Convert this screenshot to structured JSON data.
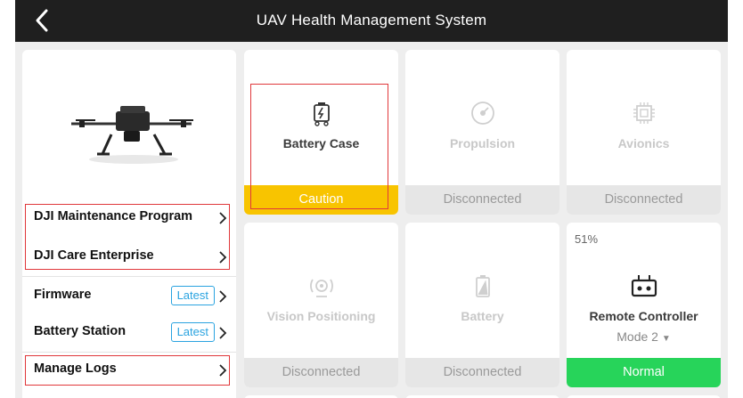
{
  "header": {
    "title": "UAV Health Management System"
  },
  "menu": [
    {
      "label": "DJI Maintenance Program"
    },
    {
      "label": "DJI Care Enterprise"
    },
    {
      "label": "Firmware",
      "badge": "Latest"
    },
    {
      "label": "Battery Station",
      "badge": "Latest"
    },
    {
      "label": "Manage Logs"
    }
  ],
  "modules": [
    {
      "name": "Battery Case",
      "status": "Caution",
      "icon": "battery-case-icon"
    },
    {
      "name": "Propulsion",
      "status": "Disconnected",
      "icon": "propulsion-icon"
    },
    {
      "name": "Avionics",
      "status": "Disconnected",
      "icon": "avionics-chip-icon"
    },
    {
      "name": "Vision Positioning",
      "status": "Disconnected",
      "icon": "vision-positioning-icon"
    },
    {
      "name": "Battery",
      "status": "Disconnected",
      "icon": "battery-icon"
    },
    {
      "name": "Remote Controller",
      "status": "Normal",
      "battery_percent": "51%",
      "mode": "Mode 2",
      "icon": "remote-controller-icon"
    }
  ],
  "colors": {
    "caution": "#f8c400",
    "normal": "#27d45a",
    "highlight": "#e0383b",
    "badge": "#2aa3e0"
  }
}
